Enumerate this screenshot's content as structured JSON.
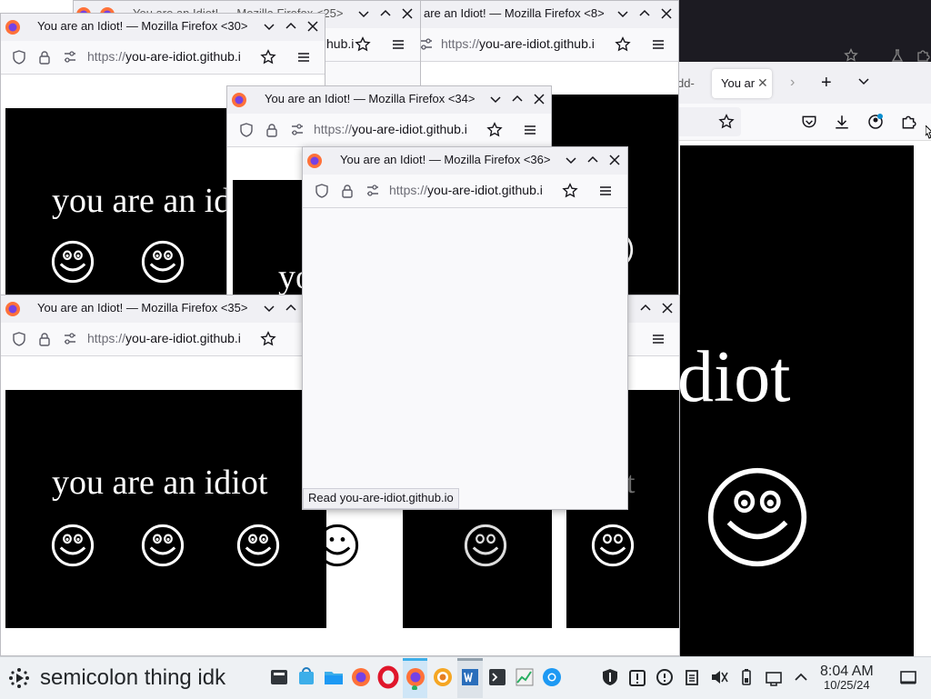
{
  "windows": {
    "w25": {
      "title": "You are an Idiot! — Mozilla Firefox <25>",
      "url_partial": "hub.i"
    },
    "w8": {
      "title": "are an Idiot! — Mozilla Firefox <8>",
      "url_prefix": "https://",
      "url_domain": "you-are-idiot.github.i"
    },
    "w30": {
      "title": "You are an Idiot! — Mozilla Firefox <30>",
      "url_prefix": "https://",
      "url_domain": "you-are-idiot.github.i",
      "page_text": "you are an id"
    },
    "w34": {
      "title": "You are an Idiot! — Mozilla Firefox <34>",
      "url_prefix": "https://",
      "url_domain": "you-are-idiot.github.i",
      "page_text": "yo"
    },
    "w36": {
      "title": "You are an Idiot! — Mozilla Firefox <36>",
      "url_prefix": "https://",
      "url_domain": "you-are-idiot.github.i",
      "status": "Read you-are-idiot.github.io"
    },
    "w35": {
      "title": "You are an Idiot! — Mozilla Firefox <35>",
      "url_prefix": "https://",
      "url_domain": "you-are-idiot.github.i",
      "page_text": "you are an idiot"
    },
    "big": {
      "tab1": "dd-",
      "tab2": "You ar",
      "page_text": "diot"
    }
  },
  "taskbar": {
    "app_name": "semicolon thing idk",
    "clock_time": "8:04 AM",
    "clock_date": "10/25/24"
  },
  "colors": {
    "page_bg": "#000000",
    "text": "#ffffff",
    "taskbar_bg": "#eef1f4",
    "firefox_orange": "#ff7139"
  }
}
